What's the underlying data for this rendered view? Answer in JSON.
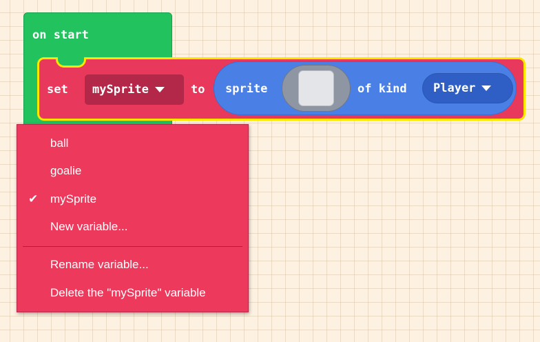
{
  "on_start": {
    "label": "on start"
  },
  "set_block": {
    "set_label": "set",
    "variable": "mySprite",
    "to_label": "to"
  },
  "sprite_block": {
    "sprite_label": "sprite",
    "of_kind_label": "of kind",
    "kind": "Player"
  },
  "menu": {
    "items": [
      {
        "label": "ball",
        "checked": false
      },
      {
        "label": "goalie",
        "checked": false
      },
      {
        "label": "mySprite",
        "checked": true
      },
      {
        "label": "New variable...",
        "checked": false
      }
    ],
    "actions": [
      {
        "label": "Rename variable..."
      },
      {
        "label": "Delete the \"mySprite\" variable"
      }
    ],
    "check_glyph": "✔"
  },
  "colors": {
    "background": "#fdf2e1",
    "on_start_green": "#22c25f",
    "set_block_red": "#e8385b",
    "selection_yellow": "#ffe600",
    "sprite_blue": "#4a7fe6",
    "menu_red": "#ed3a5c"
  },
  "icons": {
    "dropdown": "caret-down-icon",
    "checked": "checkmark-icon",
    "image": "image-swatch-icon"
  }
}
